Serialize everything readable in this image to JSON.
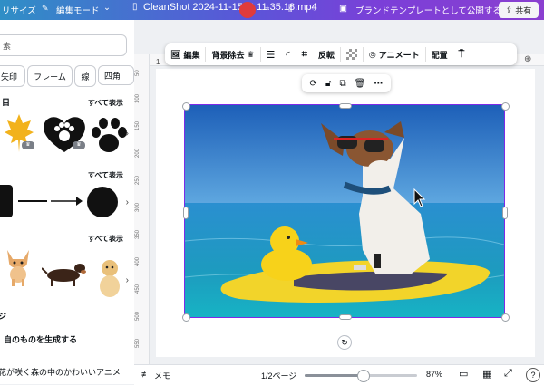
{
  "topbar": {
    "resize_label": "リサイズ",
    "edit_mode_label": "編集モード",
    "filename": "CleanShot 2024-11-15 at 11.35.18.mp4",
    "publish_label": "ブランドテンプレートとして公開する",
    "share_label": "共有"
  },
  "left_panel": {
    "search_placeholder": "素",
    "chips": [
      "矢印",
      "フレーム",
      "線",
      "四角"
    ],
    "sections": [
      {
        "title": "目",
        "see_all": "すべて表示"
      },
      {
        "title": "",
        "see_all": "すべて表示"
      },
      {
        "title": "",
        "see_all": "すべて表示"
      }
    ],
    "generate_label": "自のものを生成する",
    "prompt_text": "花が咲く森の中のかわいいアニメ"
  },
  "toolbar": {
    "edit_label": "編集",
    "remove_bg_label": "背景除去",
    "flip_label": "反転",
    "animate_label": "アニメート",
    "arrange_label": "配置"
  },
  "canvas": {
    "page_number": "1",
    "ruler_v": [
      "50",
      "100",
      "150",
      "200",
      "250",
      "300",
      "350",
      "400",
      "450",
      "500",
      "550"
    ]
  },
  "bottombar": {
    "notes_label": "メモ",
    "page_indicator": "1/2ページ",
    "zoom": "87%",
    "help": "?"
  },
  "colors": {
    "accent": "#7d2ae8",
    "topbar_start": "#2f8fc6",
    "topbar_end": "#8a3fd0",
    "sea": "#1e7fc2",
    "board": "#f2d42a"
  }
}
